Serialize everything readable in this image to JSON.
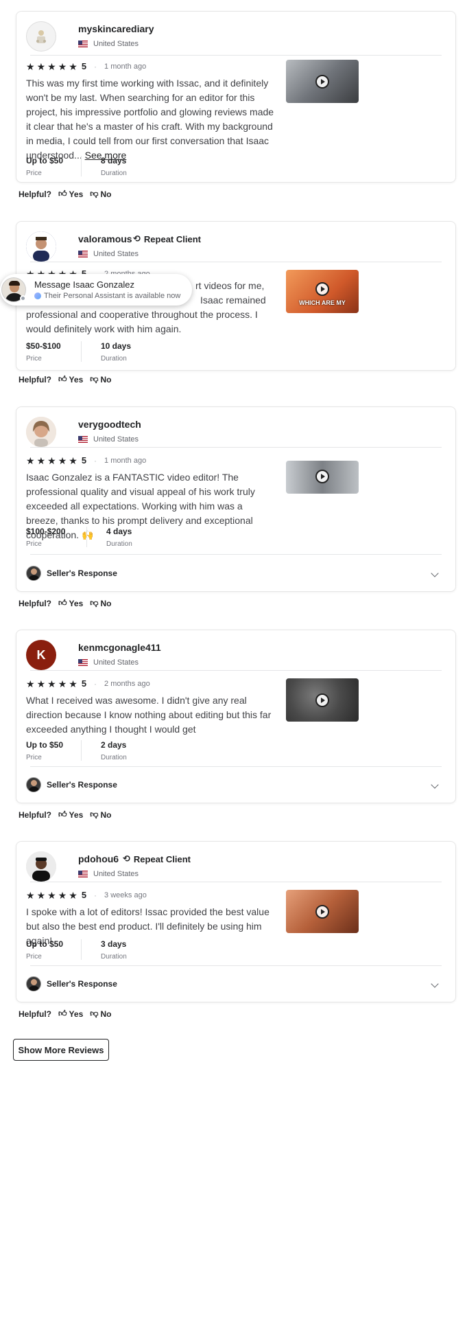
{
  "reviews": [
    {
      "username": "myskincarediary",
      "repeat_client": "",
      "country": "United States",
      "rating": "5",
      "time_ago": "1 month ago",
      "text": "This was my first time working with Issac, and it definitely won't be my last. When searching for an editor for this project, his impressive portfolio and glowing reviews made it clear that he's a master of his craft. With my background in media, I could tell from our first conversation that Isaac understood...",
      "see_more": "See more",
      "price_value": "Up to $50",
      "price_label": "Price",
      "duration_value": "8 days",
      "duration_label": "Duration",
      "seller_response": "",
      "thumb_color": "#8a8e92"
    },
    {
      "username": "valoramous",
      "repeat_client": "Repeat Client",
      "country": "United States",
      "rating": "5",
      "time_ago": "2 months ago",
      "text_visible": "rt videos for me,",
      "text_visible_2": "Isaac remained",
      "text_rest": "professional and cooperative throughout the process. I would definitely work with him again.",
      "price_value": "$50-$100",
      "price_label": "Price",
      "duration_value": "10 days",
      "duration_label": "Duration",
      "thumb_caption": "WHICH ARE MY",
      "thumb_color": "#e0743c"
    },
    {
      "username": "verygoodtech",
      "repeat_client": "",
      "country": "United States",
      "rating": "5",
      "time_ago": "1 month ago",
      "text": "Isaac Gonzalez is a FANTASTIC video editor! The professional quality and visual appeal of his work truly exceeded all expectations. Working with him was a breeze, thanks to his prompt delivery and exceptional cooperation. 🙌",
      "price_value": "$100-$200",
      "price_label": "Price",
      "duration_value": "4 days",
      "duration_label": "Duration",
      "seller_response": "Seller's Response",
      "thumb_color": "#9aa0a6"
    },
    {
      "username": "kenmcgonagle411",
      "avatar_letter": "K",
      "repeat_client": "",
      "country": "United States",
      "rating": "5",
      "time_ago": "2 months ago",
      "text": "What I received was awesome. I didn't give any real direction because I know nothing about editing but this far exceeded anything I thought I would get",
      "price_value": "Up to $50",
      "price_label": "Price",
      "duration_value": "2 days",
      "duration_label": "Duration",
      "seller_response": "Seller's Response",
      "thumb_color": "#5a5a5a"
    },
    {
      "username": "pdohou6",
      "repeat_client": "Repeat Client",
      "country": "United States",
      "rating": "5",
      "time_ago": "3 weeks ago",
      "text": "I spoke with a lot of editors! Issac provided the best value but also the best end product. I'll definitely be using him again!",
      "price_value": "Up to $50",
      "price_label": "Price",
      "duration_value": "3 days",
      "duration_label": "Duration",
      "seller_response": "Seller's Response",
      "thumb_color": "#c9784f"
    }
  ],
  "helpful": {
    "label": "Helpful?",
    "yes": "Yes",
    "no": "No"
  },
  "message_popup": {
    "title": "Message Isaac Gonzalez",
    "subtitle": "Their Personal Assistant is available now"
  },
  "show_more": "Show More Reviews"
}
